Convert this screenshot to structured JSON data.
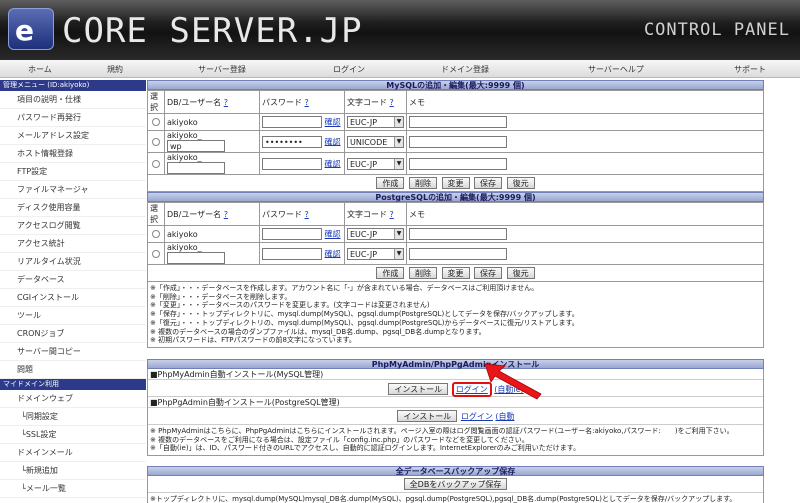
{
  "header": {
    "logo_mark": "e",
    "logo_text": "CORE SERVER.JP",
    "panel_text": "CONTROL PANEL"
  },
  "nav": [
    "ホーム",
    "規約",
    "サーバー登録",
    "ログイン",
    "ドメイン登録",
    "サーバーヘルプ",
    "サポート"
  ],
  "sidebar": {
    "head1": "管理メニュー (ID:akiyoko)",
    "items1": [
      "項目の説明・仕様",
      "パスワード再発行",
      "メールアドレス設定",
      "ホスト情報登録",
      "FTP設定",
      "ファイルマネージャ",
      "ディスク使用容量",
      "アクセスログ閲覧",
      "アクセス統計",
      "リアルタイム状況",
      "データベース",
      "CGIインストール",
      "ツール",
      "CRONジョブ",
      "サーバー間コピー",
      "問題"
    ],
    "head2": "マイドメイン利用",
    "items2": [
      "ドメインウェブ",
      "└同期設定",
      "└SSL設定",
      "ドメインメール",
      "└新規追加",
      "└メール一覧"
    ]
  },
  "mysql": {
    "title": "MySQLの追加・編集(最大:9999 個)",
    "col_select": "選択",
    "col_user": "DB/ユーザー名",
    "col_pass": "パスワード",
    "col_charset": "文字コード",
    "col_memo": "メモ",
    "help": "?",
    "confirm": "確認",
    "rows": [
      {
        "user": "akiyoko",
        "suffix": "",
        "pass": "",
        "charset": "EUC-JP",
        "memo": ""
      },
      {
        "user": "akiyoko_",
        "suffix": "wp",
        "pass": "••••••••",
        "charset": "UNICODE",
        "memo": ""
      },
      {
        "user": "akiyoko_",
        "suffix": "",
        "pass": "",
        "charset": "EUC-JP",
        "memo": ""
      }
    ],
    "buttons": [
      "作成",
      "削除",
      "変更",
      "保存",
      "復元"
    ]
  },
  "pgsql": {
    "title": "PostgreSQLの追加・編集(最大:9999 個)",
    "rows": [
      {
        "user": "akiyoko",
        "suffix": "",
        "pass": "",
        "charset": "EUC-JP",
        "memo": ""
      },
      {
        "user": "akiyoko_",
        "suffix": "",
        "pass": "",
        "charset": "EUC-JP",
        "memo": ""
      }
    ],
    "buttons": [
      "作成",
      "削除",
      "変更",
      "保存",
      "復元"
    ]
  },
  "notes": [
    "※「作成」・・・データベースを作成します。アカウント名に「-」が含まれている場合、データベースはご利用頂けません。",
    "※「削除」・・・データベースを削除します。",
    "※「変更」・・・データベースのパスワードを変更します。(文字コードは変更されません)",
    "※「保存」・・・トップディレクトリに、mysql.dump(MySQL)、pgsql.dump(PostgreSQL)としてデータを保存/バックアップします。",
    "※「復元」・・・トップディレクトリの、mysql.dump(MySQL)、pgsql.dump(PostgreSQL)からデータベースに復元/リストアします。",
    "※ 複数のデータベースの場合のダンプファイルは、mysql_DB名.dump、pgsql_DB名.dumpとなります。",
    "※ 初期パスワードは、FTPパスワードの前8文字になっています。"
  ],
  "phpadmin": {
    "title": "PhpMyAdmin/PhpPgAdminインストール",
    "mysql_label": "■PhpMyAdmin自動インストール(MySQL管理)",
    "pg_label": "■PhpPgAdmin自動インストール(PostgreSQL管理)",
    "install": "インストール",
    "login": "ログイン",
    "auto": "(自動ie)",
    "auto2": "(自動",
    "note1": "※ PhpMyAdminはこちらに、PhpPgAdminはこちらにインストールされます。ページ入室の際はログ閲覧画面の認証パスワード(ユーザー名:akiyoko,パスワード:　　)をご利用下さい。",
    "note2": "※ 複数のデータベースをご利用になる場合は、設定ファイル「config.inc.php」のパスワードなどを変更してください。",
    "note3": "※「自動(ie)」は、ID、パスワード付きのURLでアクセスし、自動的に認証ログインします。InternetExplorerのみご利用いただけます。"
  },
  "backup": {
    "title": "全データベースバックアップ保存",
    "button": "全DBをバックアップ保存",
    "note": "※トップディレクトリに、mysql.dump(MySQL)mysql_DB名.dump(MySQL)、pgsql.dump(PostgreSQL),pgsql_DB名.dump(PostgreSQL)としてデータを保存/バックアップします。"
  }
}
